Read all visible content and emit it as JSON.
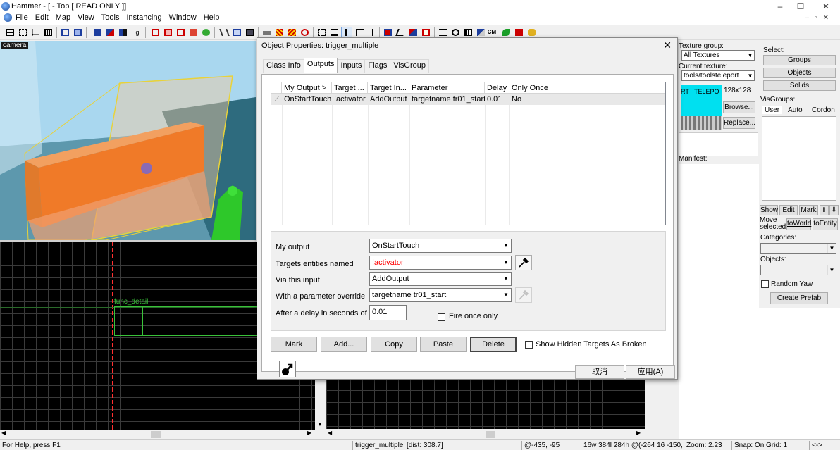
{
  "window": {
    "title": "Hammer - [ - Top [ READ ONLY ]]",
    "min": "–",
    "max": "☐",
    "close": "✕"
  },
  "menu": [
    "File",
    "Edit",
    "Map",
    "View",
    "Tools",
    "Instancing",
    "Window",
    "Help"
  ],
  "toolbar_text": {
    "cm": "CM",
    "ig": "ig"
  },
  "viewport3d": {
    "label": "camera"
  },
  "viewport2d": {
    "entity_label": "func_detail"
  },
  "texture_panel": {
    "group_label": "Texture group:",
    "group_value": "All Textures",
    "current_label": "Current texture:",
    "current_value": "tools/toolsteleport",
    "size": "128x128",
    "preview_text": "RT   TELEPO",
    "browse": "Browse...",
    "replace": "Replace...",
    "manifest": "Manifest:"
  },
  "select_panel": {
    "select_label": "Select:",
    "groups": "Groups",
    "objects": "Objects",
    "solids": "Solids",
    "visgroups_label": "VisGroups:",
    "tabs": [
      "User",
      "Auto",
      "Cordon"
    ],
    "show": "Show",
    "edit": "Edit",
    "mark": "Mark",
    "up": "⬆",
    "down": "⬇",
    "move_selected": "Move selected:",
    "toworld": "toWorld",
    "toentity": "toEntity",
    "categories": "Categories:",
    "objects_label": "Objects:",
    "random_yaw": "Random Yaw",
    "create_prefab": "Create Prefab"
  },
  "dialog": {
    "title": "Object Properties: trigger_multiple",
    "close": "✕",
    "tabs": [
      "Class Info",
      "Outputs",
      "Inputs",
      "Flags",
      "VisGroup"
    ],
    "columns": [
      "My Output  >",
      "Target ...",
      "Target In...",
      "Parameter",
      "Delay",
      "Only Once"
    ],
    "rows": [
      {
        "output": "OnStartTouch",
        "target": "!activator",
        "input": "AddOutput",
        "parameter": "targetname tr01_start",
        "delay": "0.01",
        "once": "No"
      }
    ],
    "fields": {
      "my_output_label": "My output",
      "my_output": "OnStartTouch",
      "targets_label": "Targets entities named",
      "targets": "!activator",
      "via_label": "Via this input",
      "via": "AddOutput",
      "param_label": "With a parameter override",
      "param": "targetname tr01_start",
      "delay_label": "After a delay in seconds of",
      "delay": "0.01",
      "fire_once": "Fire once only"
    },
    "buttons": {
      "mark": "Mark",
      "add": "Add...",
      "copy": "Copy",
      "paste": "Paste",
      "delete": "Delete",
      "show_hidden": "Show Hidden Targets As Broken",
      "cancel": "取消",
      "apply": "应用(A)"
    },
    "accent_red": "#ff0000"
  },
  "status": {
    "help": "For Help, press F1",
    "object": "trigger_multiple",
    "dist": "[dist: 308.7]",
    "coords": "@-435, -95",
    "size": "16w 384l 284h @(-264 16 -150,",
    "zoom": "Zoom: 2.23",
    "snap": "Snap: On Grid: 1",
    "arrows": "<->"
  }
}
